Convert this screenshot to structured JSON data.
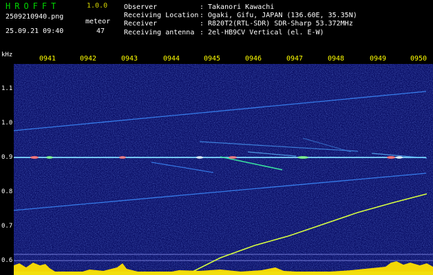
{
  "header": {
    "app_title": "HROFFT",
    "version": "1.0.0",
    "file_name": "2509210940.png",
    "datetime": "25.09.21 09:40",
    "meteor_label": "meteor",
    "meteor_count": "47"
  },
  "station_info": [
    {
      "key": "Observer",
      "value": "Takanori Kawachi"
    },
    {
      "key": "Receiving Location",
      "value": "Ogaki, Gifu, JAPAN (136.60E, 35.35N)"
    },
    {
      "key": "Receiver",
      "value": "R820T2(RTL-SDR) SDR-Sharp 53.372MHz"
    },
    {
      "key": "Receiving antenna",
      "value": "2el-HB9CV Vertical (el. E-W)"
    }
  ],
  "axis": {
    "unit": "kHz",
    "y_ticks": [
      "1.1",
      "1.0",
      "0.9",
      "0.8",
      "0.7",
      "0.6"
    ],
    "x_ticks": [
      "0941",
      "0942",
      "0943",
      "0944",
      "0945",
      "0946",
      "0947",
      "0948",
      "0949",
      "0950"
    ]
  },
  "colors": {
    "background": "#000000",
    "spectrogram_bg": "#0a0f66",
    "trace": "#3c8cff",
    "carrier": "#7fd8ff",
    "rising_trace": "#d8ff40",
    "noise_bar": "#ffe000",
    "baseline": "#00c8ff"
  }
}
